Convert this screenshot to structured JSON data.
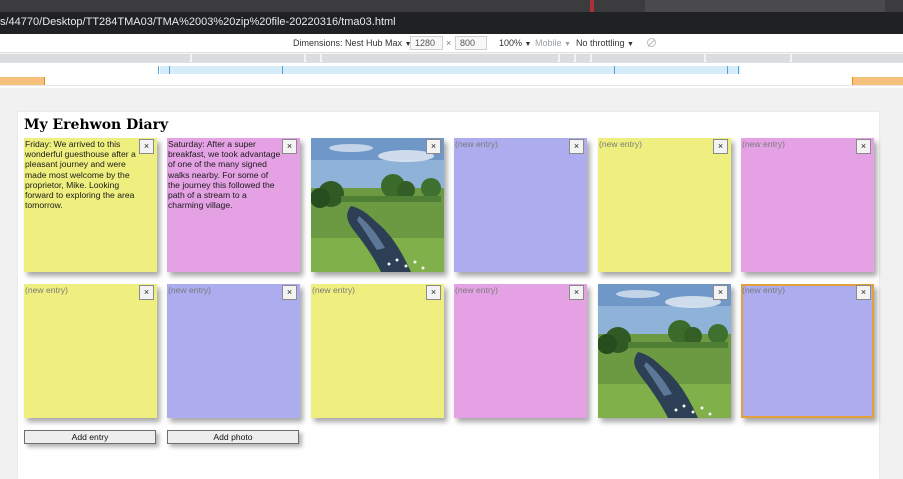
{
  "browser": {
    "url": "s/44770/Desktop/TT284TMA03/TMA%2003%20zip%20file-20220316/tma03.html"
  },
  "device_toolbar": {
    "dimensions_label": "Dimensions: Nest Hub Max",
    "width": "1280",
    "times": "×",
    "height": "800",
    "zoom": "100%",
    "mode": "Mobile",
    "throttling": "No throttling",
    "dropdown_glyph": "▼"
  },
  "page": {
    "title": "My Erehwon Diary",
    "close_glyph": "×",
    "placeholder": "(new entry)",
    "notes": [
      {
        "color": "yellow",
        "type": "text",
        "text": "Friday: We arrived to this wonderful guesthouse after a pleasant journey and were made most welcome by the proprietor, Mike. Looking forward to exploring the area tomorrow."
      },
      {
        "color": "pink",
        "type": "text",
        "text": "Saturday: After a super breakfast, we took advantage of one of the many signed walks nearby. For some of the journey this followed the path of a stream to a charming village."
      },
      {
        "color": "photo",
        "type": "photo",
        "text": ""
      },
      {
        "color": "blue",
        "type": "empty",
        "text": ""
      },
      {
        "color": "yellow",
        "type": "empty",
        "text": ""
      },
      {
        "color": "pink",
        "type": "empty",
        "text": ""
      },
      {
        "color": "yellow",
        "type": "empty",
        "text": ""
      },
      {
        "color": "blue",
        "type": "empty",
        "text": ""
      },
      {
        "color": "yellow",
        "type": "empty",
        "text": ""
      },
      {
        "color": "pink",
        "type": "empty",
        "text": ""
      },
      {
        "color": "photo",
        "type": "photo",
        "text": ""
      },
      {
        "color": "blue",
        "type": "empty",
        "text": "",
        "selected": true
      }
    ],
    "buttons": {
      "add_entry": "Add entry",
      "add_photo": "Add photo"
    }
  },
  "colors": {
    "yellow": "#efef7f",
    "pink": "#e4a2e4",
    "blue": "#acacee",
    "selected_outline": "#e0a13a"
  },
  "icons": {
    "close": "close-icon",
    "dropdown": "chevron-down-icon",
    "throttle_off": "no-entry-icon",
    "photo": "stream-landscape-image"
  }
}
